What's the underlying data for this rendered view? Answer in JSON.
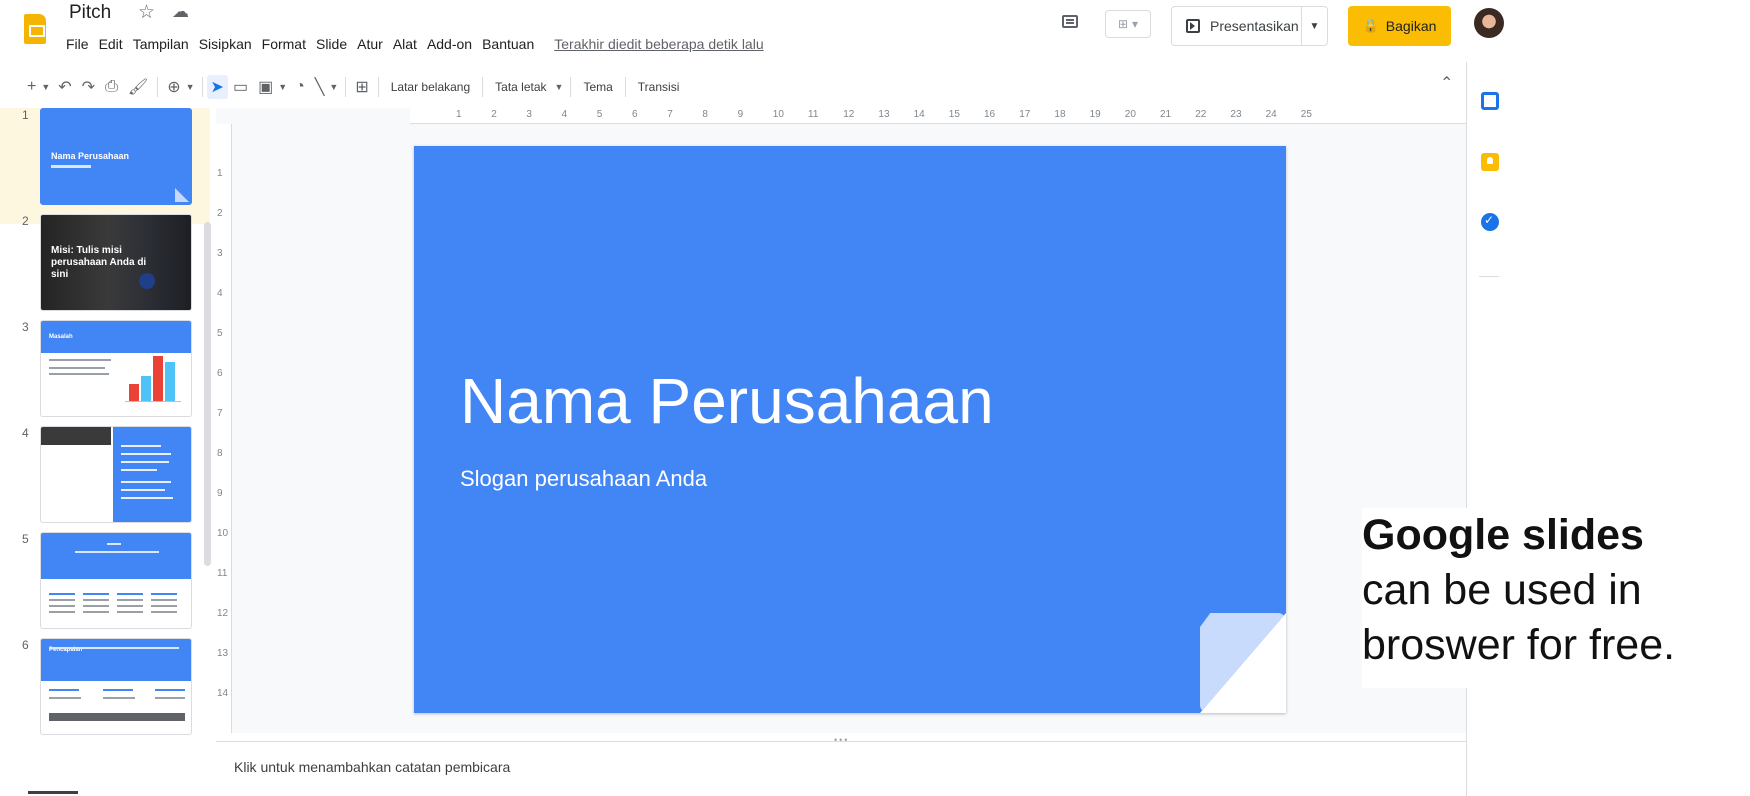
{
  "header": {
    "doc_title": "Pitch",
    "menu": [
      "File",
      "Edit",
      "Tampilan",
      "Sisipkan",
      "Format",
      "Slide",
      "Atur",
      "Alat",
      "Add-on",
      "Bantuan"
    ],
    "last_edit": "Terakhir diedit beberapa detik lalu",
    "present_label": "Presentasikan",
    "share_label": "Bagikan"
  },
  "toolbar": {
    "background": "Latar belakang",
    "layout": "Tata letak",
    "theme": "Tema",
    "transition": "Transisi"
  },
  "ruler": {
    "horizontal_ticks": [
      "1",
      "2",
      "3",
      "4",
      "5",
      "6",
      "7",
      "8",
      "9",
      "10",
      "11",
      "12",
      "13",
      "14",
      "15",
      "16",
      "17",
      "18",
      "19",
      "20",
      "21",
      "22",
      "23",
      "24",
      "25"
    ],
    "vertical_ticks": [
      "1",
      "2",
      "3",
      "4",
      "5",
      "6",
      "7",
      "8",
      "9",
      "10",
      "11",
      "12",
      "13",
      "14"
    ]
  },
  "filmstrip": {
    "numbers": [
      "1",
      "2",
      "3",
      "4",
      "5",
      "6"
    ],
    "slide1_title": "Nama Perusahaan",
    "slide2_title": "Misi: Tulis misi perusahaan Anda di sini",
    "slide3_title": "Masalah",
    "slide6_title": "Pencapaian"
  },
  "slide": {
    "title": "Nama Perusahaan",
    "subtitle": "Slogan perusahaan Anda"
  },
  "notes": {
    "placeholder": "Klik untuk menambahkan catatan pembicara"
  },
  "caption": {
    "line1": "Google slides",
    "line2": "can be used in",
    "line3": "broswer for free."
  },
  "colors": {
    "slide_blue": "#4285f4",
    "share_yellow": "#fbbc04",
    "selection_blue": "#1a73e8"
  }
}
